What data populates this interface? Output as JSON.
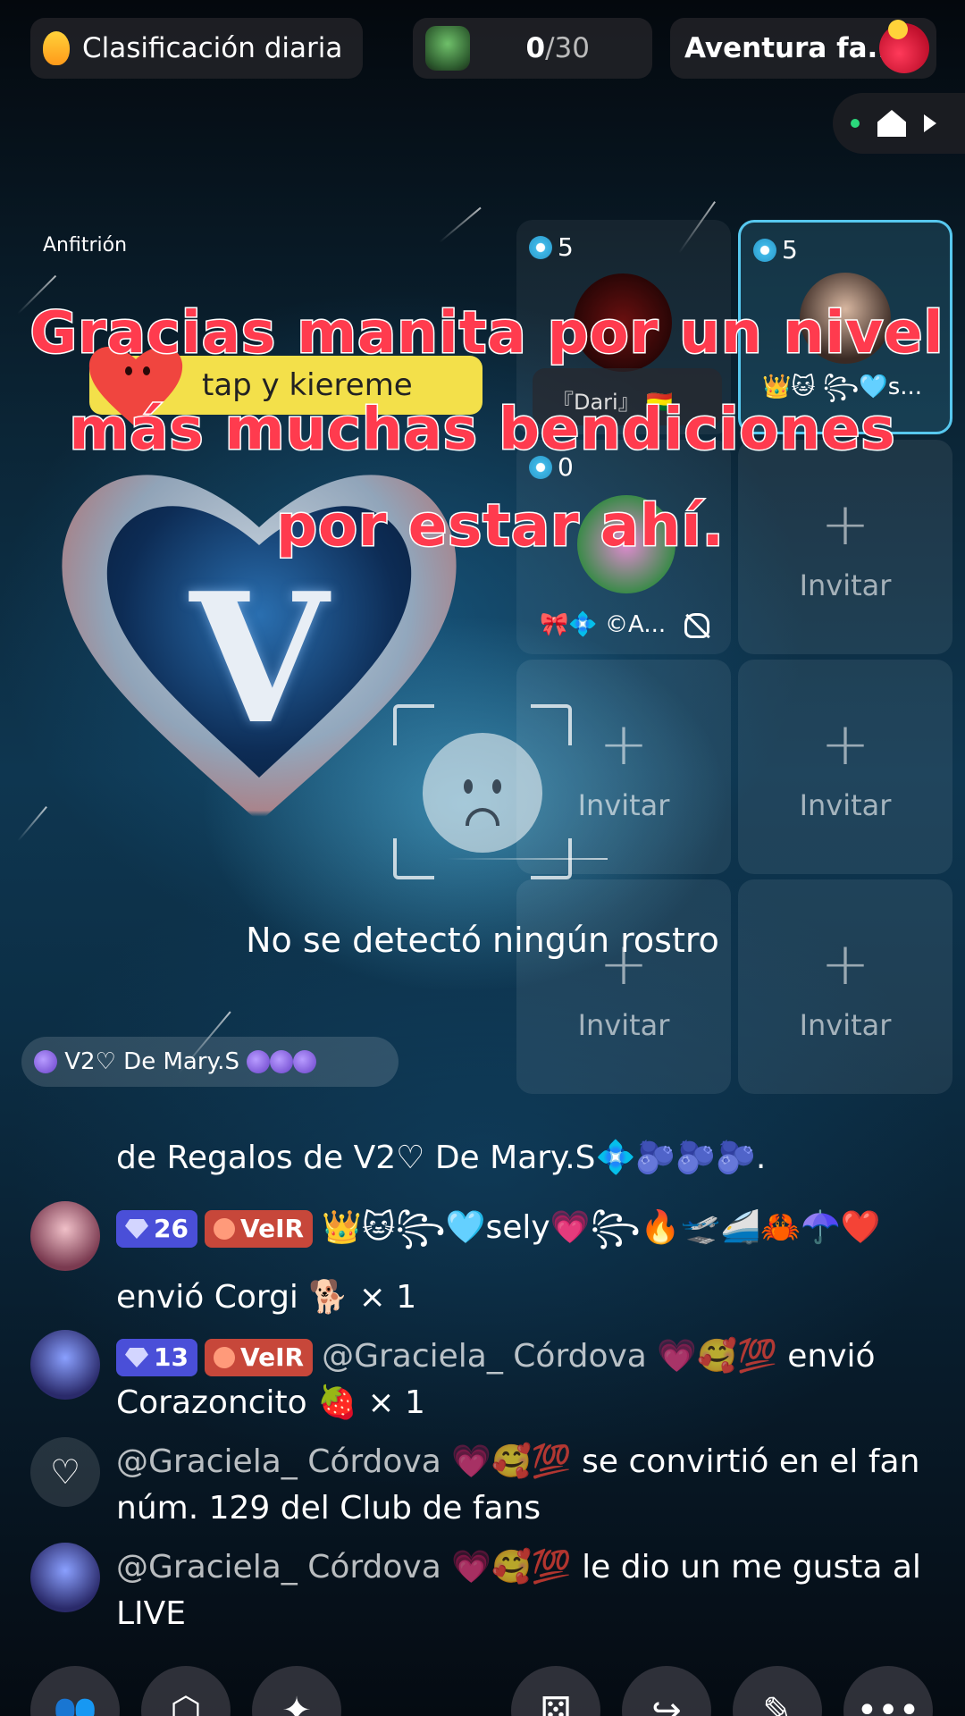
{
  "top": {
    "rank_label": "Clasificación diaria",
    "score_current": "0",
    "score_total": "/30",
    "adventure_label": "Aventura fa..."
  },
  "stage": {
    "host_label": "Anfitrión",
    "heart_letter": "V",
    "tap_badge": "tap y kiereme",
    "caption_lines": [
      "Gracias manita por un nivel",
      "más muchas bendiciones",
      "por estar ahí."
    ],
    "no_face": "No se detectó ningún rostro",
    "from_tag": "V2♡ De Mary.S"
  },
  "seats": [
    {
      "coins": "5",
      "name": "",
      "tag": "『Dari』 🇧🇴"
    },
    {
      "coins": "5",
      "name": "👑🐱 ꧂🩵s..."
    },
    {
      "coins": "0",
      "name": "🎀💠 ©A..."
    },
    {
      "invite": "Invitar",
      "plus": "+"
    },
    {
      "invite": "Invitar",
      "plus": "+"
    },
    {
      "invite": "Invitar",
      "plus": "+"
    },
    {
      "invite": "Invitar",
      "plus": "+"
    },
    {
      "invite": "Invitar",
      "plus": "+"
    }
  ],
  "chat": [
    {
      "text": "de Regalos de V2♡ De Mary.S💠🫐🫐🫐."
    },
    {
      "level": "26",
      "vip": "VeIR",
      "user": "👑🐱꧂🩵sely💗꧂🔥🛫🚄🦀☂️❤️",
      "text": "envió Corgi 🐕 × 1"
    },
    {
      "level": "13",
      "vip": "VeIR",
      "user": "@Graciela_ Córdova 💗🥰💯",
      "action": "envió",
      "text": "Corazoncito 🍓 × 1"
    },
    {
      "user": "@Graciela_ Córdova 💗🥰💯",
      "text": "se convirtió en el fan núm. 129 del Club de fans"
    },
    {
      "user": "@Graciela_ Córdova 💗🥰💯",
      "text": "le dio un me gusta al LIVE"
    }
  ],
  "icons": [
    "fire-icon",
    "badge-icon",
    "drink-icon",
    "live-dot-icon",
    "home-icon",
    "play-icon",
    "coin-icon",
    "mute-icon",
    "plus-icon",
    "sad-face-icon",
    "heart-outline-icon",
    "people-icon",
    "box-icon",
    "sparkle-icon",
    "dice-icon",
    "share-icon",
    "wand-icon",
    "more-icon"
  ]
}
